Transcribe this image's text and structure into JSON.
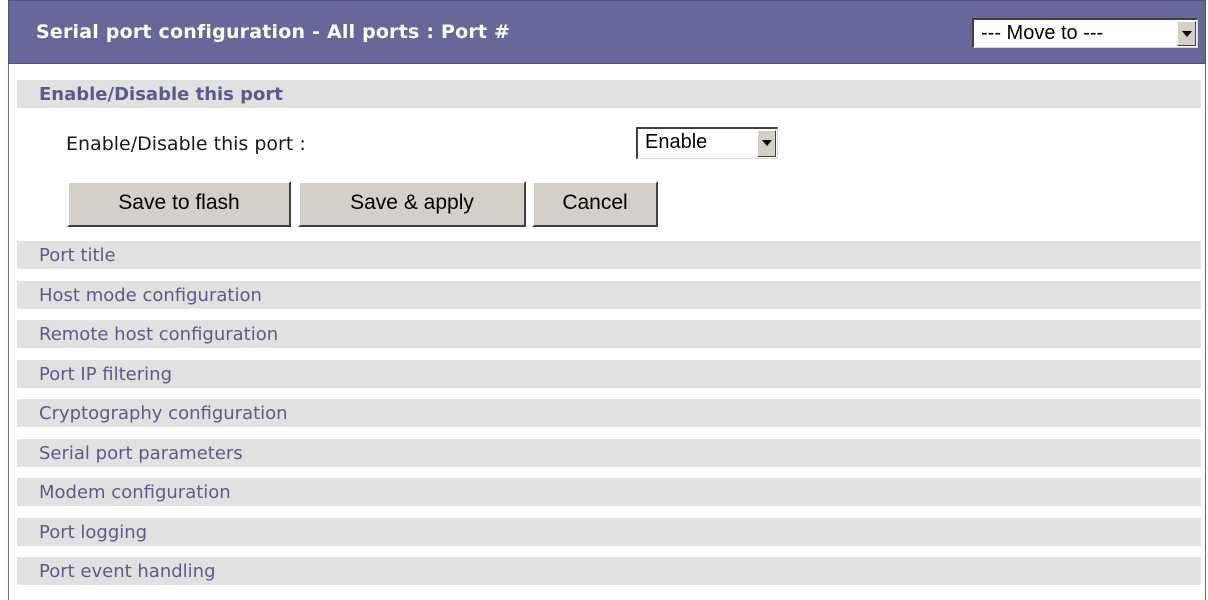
{
  "header": {
    "title": "Serial port configuration - All ports : Port #",
    "move_to": "--- Move to ---"
  },
  "enable_section": {
    "heading": "Enable/Disable this port",
    "field_label": "Enable/Disable this port :",
    "field_value": "Enable"
  },
  "buttons": {
    "save_flash": "Save to flash",
    "save_apply": "Save & apply",
    "cancel": "Cancel"
  },
  "sections": [
    "Port title",
    "Host mode configuration",
    "Remote host configuration",
    "Port IP filtering",
    "Cryptography configuration",
    "Serial port parameters",
    "Modem configuration",
    "Port logging",
    "Port event handling"
  ]
}
